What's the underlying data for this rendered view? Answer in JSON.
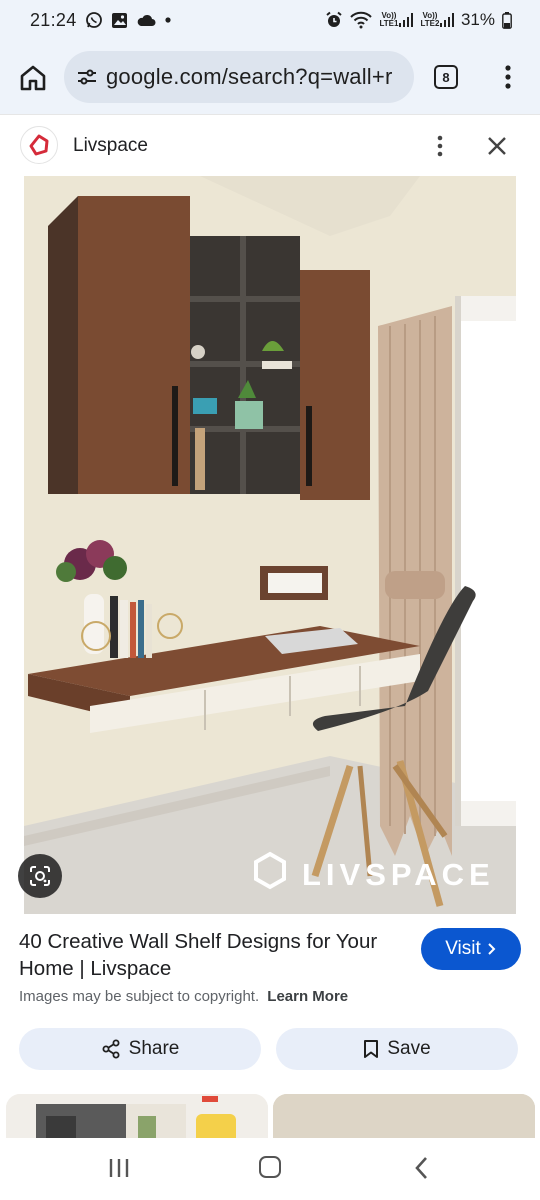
{
  "status_bar": {
    "time": "21:24",
    "battery": "31%",
    "sim1_label": "Vo)) LTE1",
    "sim2_label": "Vo)) LTE2"
  },
  "browser": {
    "url": "google.com/search?q=wall+r",
    "tab_count": "8"
  },
  "source": {
    "name": "Livspace"
  },
  "image": {
    "watermark": "LIVSPACE"
  },
  "result": {
    "title": "40 Creative Wall Shelf Designs for Your Home | Livspace",
    "visit_label": "Visit",
    "copyright": "Images may be subject to copyright.",
    "learn_more": "Learn More",
    "share_label": "Share",
    "save_label": "Save"
  },
  "colors": {
    "accent": "#0b57d0",
    "chip_bg": "#e8eef9",
    "url_bar_bg": "#eef3fa"
  }
}
